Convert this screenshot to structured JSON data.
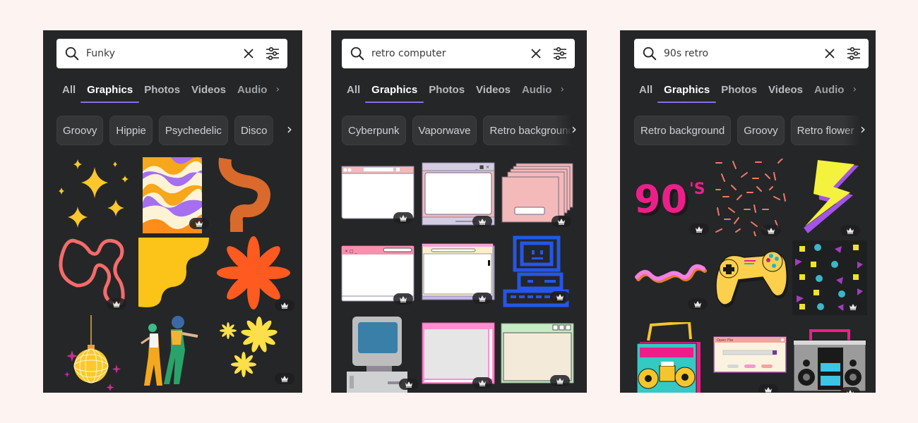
{
  "panels": [
    {
      "search": {
        "query": "Funky",
        "icon": "search-icon",
        "clear_icon": "close-icon",
        "filter_icon": "filter-sliders-icon"
      },
      "tabs": [
        {
          "label": "All",
          "active": false
        },
        {
          "label": "Graphics",
          "active": true
        },
        {
          "label": "Photos",
          "active": false
        },
        {
          "label": "Videos",
          "active": false
        },
        {
          "label": "Audio",
          "active": false
        }
      ],
      "tabs_next": "›",
      "chips": [
        "Groovy",
        "Hippie",
        "Psychedelic",
        "Disco"
      ],
      "chips_next": "›",
      "items": [
        {
          "name": "sparkles",
          "premium": false
        },
        {
          "name": "wavy-psychedelic-pattern",
          "premium": true
        },
        {
          "name": "orange-squiggle",
          "premium": false
        },
        {
          "name": "pink-squiggle-loop",
          "premium": true
        },
        {
          "name": "yellow-wavy-corner",
          "premium": false
        },
        {
          "name": "orange-flower",
          "premium": true
        },
        {
          "name": "disco-ball",
          "premium": false
        },
        {
          "name": "dancing-couple",
          "premium": false
        },
        {
          "name": "yellow-flowers",
          "premium": true
        }
      ]
    },
    {
      "search": {
        "query": "retro computer",
        "icon": "search-icon",
        "clear_icon": "close-icon",
        "filter_icon": "filter-sliders-icon"
      },
      "tabs": [
        {
          "label": "All",
          "active": false
        },
        {
          "label": "Graphics",
          "active": true
        },
        {
          "label": "Photos",
          "active": false
        },
        {
          "label": "Videos",
          "active": false
        },
        {
          "label": "Audio",
          "active": false
        }
      ],
      "tabs_next": "›",
      "chips": [
        "Cyberpunk",
        "Vaporwave",
        "Retro background"
      ],
      "chips_next": "›",
      "items": [
        {
          "name": "pink-browser-window",
          "premium": true
        },
        {
          "name": "lavender-window-frame",
          "premium": true
        },
        {
          "name": "stacked-pink-windows",
          "premium": true
        },
        {
          "name": "pink-search-window",
          "premium": true
        },
        {
          "name": "cream-browser-window",
          "premium": true
        },
        {
          "name": "blue-pixel-computer",
          "premium": true
        },
        {
          "name": "vintage-computer",
          "premium": true
        },
        {
          "name": "pink-scroll-window",
          "premium": true
        },
        {
          "name": "green-cream-window",
          "premium": true
        }
      ]
    },
    {
      "search": {
        "query": "90s retro",
        "icon": "search-icon",
        "clear_icon": "close-icon",
        "filter_icon": "filter-sliders-icon"
      },
      "tabs": [
        {
          "label": "All",
          "active": false
        },
        {
          "label": "Graphics",
          "active": true
        },
        {
          "label": "Photos",
          "active": false
        },
        {
          "label": "Videos",
          "active": false
        },
        {
          "label": "Audio",
          "active": false
        }
      ],
      "tabs_next": "›",
      "chips": [
        "Retro background",
        "Groovy",
        "Retro flower"
      ],
      "chips_next": "›",
      "items": [
        {
          "name": "90s-text",
          "premium": true,
          "text": "90",
          "sup": "'S"
        },
        {
          "name": "confetti-lines",
          "premium": true
        },
        {
          "name": "lightning-bolt",
          "premium": true
        },
        {
          "name": "pink-squiggle",
          "premium": true
        },
        {
          "name": "game-controller",
          "premium": false
        },
        {
          "name": "memphis-pattern",
          "premium": true
        },
        {
          "name": "pink-boombox",
          "premium": false
        },
        {
          "name": "open-file-dialog",
          "premium": true,
          "dialog_title": "Open File"
        },
        {
          "name": "gray-boombox",
          "premium": true
        }
      ]
    }
  ],
  "colors": {
    "page_bg": "#fdf3f0",
    "panel_bg": "#252627",
    "tab_underline": "#8b6de8",
    "chip_bg": "#343537"
  }
}
